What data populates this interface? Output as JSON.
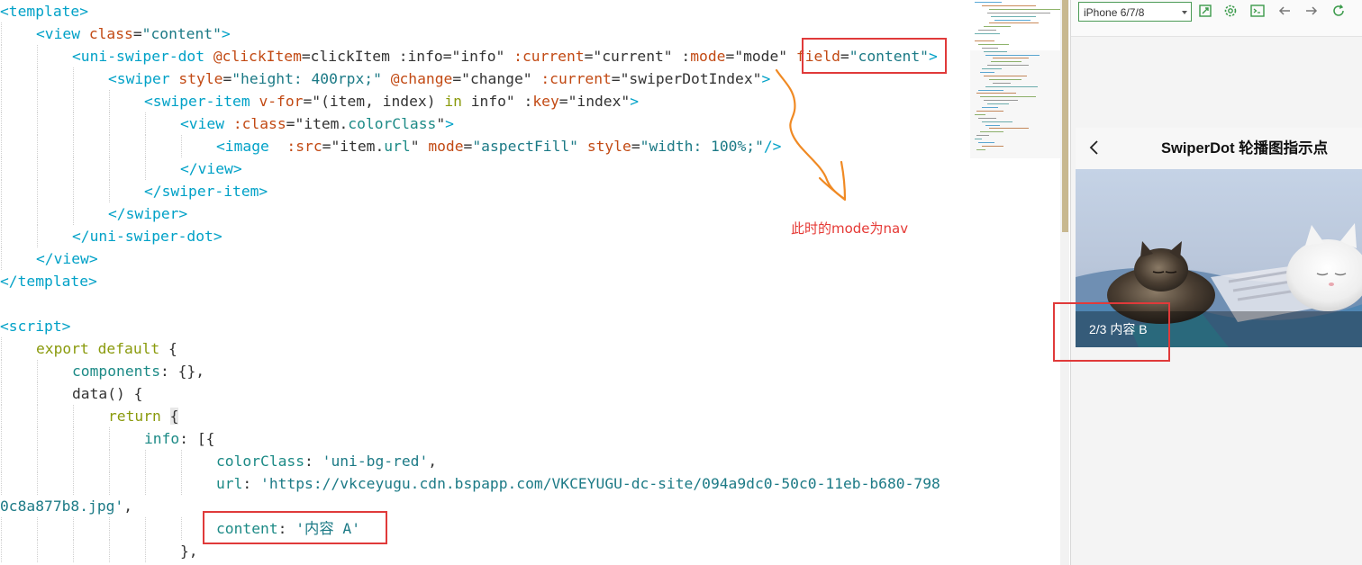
{
  "editor": {
    "lines": [
      {
        "indent": 0,
        "tokens": [
          {
            "c": "t-tag",
            "t": "<template>"
          }
        ]
      },
      {
        "indent": 1,
        "tokens": [
          {
            "c": "t-tag",
            "t": "<view "
          },
          {
            "c": "t-attr",
            "t": "class"
          },
          {
            "c": "t-op",
            "t": "="
          },
          {
            "c": "t-str",
            "t": "\"content\""
          },
          {
            "c": "t-tag",
            "t": ">"
          }
        ]
      },
      {
        "indent": 2,
        "tokens": [
          {
            "c": "t-tag",
            "t": "<uni-swiper-dot "
          },
          {
            "c": "t-attr",
            "t": "@clickItem"
          },
          {
            "c": "t-op",
            "t": "=clickItem :info="
          },
          {
            "c": "t-plain",
            "t": "\"info\""
          },
          {
            "c": "t-op",
            "t": " "
          },
          {
            "c": "t-attr",
            "t": ":current"
          },
          {
            "c": "t-op",
            "t": "="
          },
          {
            "c": "t-plain",
            "t": "\"current\""
          },
          {
            "c": "t-op",
            "t": " :"
          },
          {
            "c": "t-attr",
            "t": "mode"
          },
          {
            "c": "t-op",
            "t": "="
          },
          {
            "c": "t-plain",
            "t": "\"mode\""
          },
          {
            "c": "t-op",
            "t": " "
          },
          {
            "c": "t-attr",
            "t": "field"
          },
          {
            "c": "t-op",
            "t": "="
          },
          {
            "c": "t-str",
            "t": "\"content\""
          },
          {
            "c": "t-tag",
            "t": ">"
          }
        ]
      },
      {
        "indent": 3,
        "tokens": [
          {
            "c": "t-tag",
            "t": "<swiper "
          },
          {
            "c": "t-attr",
            "t": "style"
          },
          {
            "c": "t-op",
            "t": "="
          },
          {
            "c": "t-str",
            "t": "\"height: 400rpx;\""
          },
          {
            "c": "t-op",
            "t": " "
          },
          {
            "c": "t-attr",
            "t": "@change"
          },
          {
            "c": "t-op",
            "t": "="
          },
          {
            "c": "t-plain",
            "t": "\"change\""
          },
          {
            "c": "t-op",
            "t": " "
          },
          {
            "c": "t-attr",
            "t": ":current"
          },
          {
            "c": "t-op",
            "t": "="
          },
          {
            "c": "t-plain",
            "t": "\"swiperDotIndex\""
          },
          {
            "c": "t-tag",
            "t": ">"
          }
        ]
      },
      {
        "indent": 4,
        "tokens": [
          {
            "c": "t-tag",
            "t": "<swiper-item "
          },
          {
            "c": "t-attr",
            "t": "v-for"
          },
          {
            "c": "t-op",
            "t": "="
          },
          {
            "c": "t-plain",
            "t": "\"(item, index) "
          },
          {
            "c": "t-kw",
            "t": "in"
          },
          {
            "c": "t-plain",
            "t": " info\""
          },
          {
            "c": "t-op",
            "t": " :"
          },
          {
            "c": "t-attr",
            "t": "key"
          },
          {
            "c": "t-op",
            "t": "="
          },
          {
            "c": "t-plain",
            "t": "\"index\""
          },
          {
            "c": "t-tag",
            "t": ">"
          }
        ]
      },
      {
        "indent": 5,
        "tokens": [
          {
            "c": "t-tag",
            "t": "<view "
          },
          {
            "c": "t-attr",
            "t": ":class"
          },
          {
            "c": "t-op",
            "t": "="
          },
          {
            "c": "t-plain",
            "t": "\"item."
          },
          {
            "c": "t-prop",
            "t": "colorClass"
          },
          {
            "c": "t-plain",
            "t": "\""
          },
          {
            "c": "t-tag",
            "t": ">"
          }
        ]
      },
      {
        "indent": 6,
        "tokens": [
          {
            "c": "t-tag",
            "t": "<image  "
          },
          {
            "c": "t-attr",
            "t": ":src"
          },
          {
            "c": "t-op",
            "t": "="
          },
          {
            "c": "t-plain",
            "t": "\"item."
          },
          {
            "c": "t-prop",
            "t": "url"
          },
          {
            "c": "t-plain",
            "t": "\""
          },
          {
            "c": "t-op",
            "t": " "
          },
          {
            "c": "t-attr",
            "t": "mode"
          },
          {
            "c": "t-op",
            "t": "="
          },
          {
            "c": "t-str",
            "t": "\"aspectFill\""
          },
          {
            "c": "t-op",
            "t": " "
          },
          {
            "c": "t-attr",
            "t": "style"
          },
          {
            "c": "t-op",
            "t": "="
          },
          {
            "c": "t-str",
            "t": "\"width: 100%;\""
          },
          {
            "c": "t-tag",
            "t": "/>"
          }
        ]
      },
      {
        "indent": 5,
        "tokens": [
          {
            "c": "t-tag",
            "t": "</view>"
          }
        ]
      },
      {
        "indent": 4,
        "tokens": [
          {
            "c": "t-tag",
            "t": "</swiper-item>"
          }
        ]
      },
      {
        "indent": 3,
        "tokens": [
          {
            "c": "t-tag",
            "t": "</swiper>"
          }
        ]
      },
      {
        "indent": 2,
        "tokens": [
          {
            "c": "t-tag",
            "t": "</uni-swiper-dot>"
          }
        ]
      },
      {
        "indent": 1,
        "tokens": [
          {
            "c": "t-tag",
            "t": "</view>"
          }
        ]
      },
      {
        "indent": 0,
        "tokens": [
          {
            "c": "t-tag",
            "t": "</template>"
          }
        ]
      },
      {
        "indent": 0,
        "tokens": []
      },
      {
        "indent": 0,
        "tokens": [
          {
            "c": "t-tag",
            "t": "<script>"
          }
        ]
      },
      {
        "indent": 1,
        "tokens": [
          {
            "c": "t-kw",
            "t": "export default "
          },
          {
            "c": "t-plain",
            "t": "{"
          }
        ]
      },
      {
        "indent": 2,
        "tokens": [
          {
            "c": "t-prop",
            "t": "components"
          },
          {
            "c": "t-plain",
            "t": ": {},"
          }
        ]
      },
      {
        "indent": 2,
        "tokens": [
          {
            "c": "t-fn",
            "t": "data"
          },
          {
            "c": "t-plain",
            "t": "() {"
          }
        ]
      },
      {
        "indent": 3,
        "tokens": [
          {
            "c": "t-kw",
            "t": "return "
          },
          {
            "c": "bracket-hl",
            "t": "{"
          }
        ]
      },
      {
        "indent": 4,
        "tokens": [
          {
            "c": "t-prop",
            "t": "info"
          },
          {
            "c": "t-plain",
            "t": ": [{"
          }
        ]
      },
      {
        "indent": 6,
        "tokens": [
          {
            "c": "t-prop",
            "t": "colorClass"
          },
          {
            "c": "t-plain",
            "t": ": "
          },
          {
            "c": "t-str",
            "t": "'uni-bg-red'"
          },
          {
            "c": "t-plain",
            "t": ","
          }
        ]
      },
      {
        "indent": 6,
        "tokens": [
          {
            "c": "t-prop",
            "t": "url"
          },
          {
            "c": "t-plain",
            "t": ": "
          },
          {
            "c": "t-str",
            "t": "'https://vkceyugu.cdn.bspapp.com/VKCEYUGU-dc-site/094a9dc0-50c0-11eb-b680-798"
          }
        ]
      },
      {
        "indent": 0,
        "tokens": [
          {
            "c": "t-str",
            "t": "0c8a877b8.jpg'"
          },
          {
            "c": "t-plain",
            "t": ","
          }
        ]
      },
      {
        "indent": 6,
        "tokens": [
          {
            "c": "t-prop",
            "t": "content"
          },
          {
            "c": "t-plain",
            "t": ": "
          },
          {
            "c": "t-str",
            "t": "'内容 A'"
          }
        ]
      },
      {
        "indent": 5,
        "tokens": [
          {
            "c": "t-plain",
            "t": "},"
          }
        ]
      }
    ],
    "annotation_text": "此时的mode为nav"
  },
  "preview": {
    "device": "iPhone 6/7/8",
    "toolbar_icons": [
      "screenshot-icon",
      "settings-icon",
      "console-icon",
      "back-arrow-icon",
      "forward-arrow-icon",
      "refresh-icon"
    ],
    "nav_title": "SwiperDot 轮播图指示点",
    "swiper_dot_text": "2/3 内容 B",
    "colors": {
      "accent": "#4c9a56",
      "highlight": "#e03a3a",
      "annotation": "#e53935",
      "arrow": "#f08a24"
    }
  }
}
